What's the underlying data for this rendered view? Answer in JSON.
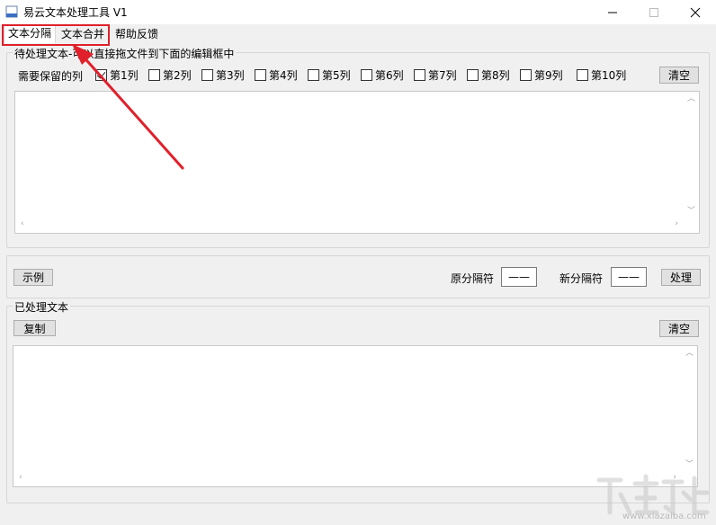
{
  "window": {
    "title": "易云文本处理工具 V1"
  },
  "tabs": [
    {
      "label": "文本分隔",
      "active": true
    },
    {
      "label": "文本合并",
      "active": false
    },
    {
      "label": "帮助反馈",
      "active": false
    }
  ],
  "input_group": {
    "title": "待处理文本-可以直接拖文件到下面的编辑框中",
    "columns_label": "需要保留的列",
    "columns": [
      {
        "label": "第1列",
        "checked": true
      },
      {
        "label": "第2列",
        "checked": false
      },
      {
        "label": "第3列",
        "checked": false
      },
      {
        "label": "第4列",
        "checked": false
      },
      {
        "label": "第5列",
        "checked": false
      },
      {
        "label": "第6列",
        "checked": false
      },
      {
        "label": "第7列",
        "checked": false
      },
      {
        "label": "第8列",
        "checked": false
      },
      {
        "label": "第9列",
        "checked": false
      },
      {
        "label": "第10列",
        "checked": false
      }
    ],
    "clear_label": "清空",
    "text_value": ""
  },
  "middle": {
    "example_label": "示例",
    "orig_sep_label": "原分隔符",
    "orig_sep_value": "——",
    "new_sep_label": "新分隔符",
    "new_sep_value": "——",
    "process_label": "处理"
  },
  "output_group": {
    "title": "已处理文本",
    "copy_label": "复制",
    "clear_label": "清空",
    "text_value": ""
  },
  "watermark": {
    "text": "www.xiazaiba.com"
  },
  "colors": {
    "highlight": "#e0202a",
    "background": "#f0f0f0"
  }
}
